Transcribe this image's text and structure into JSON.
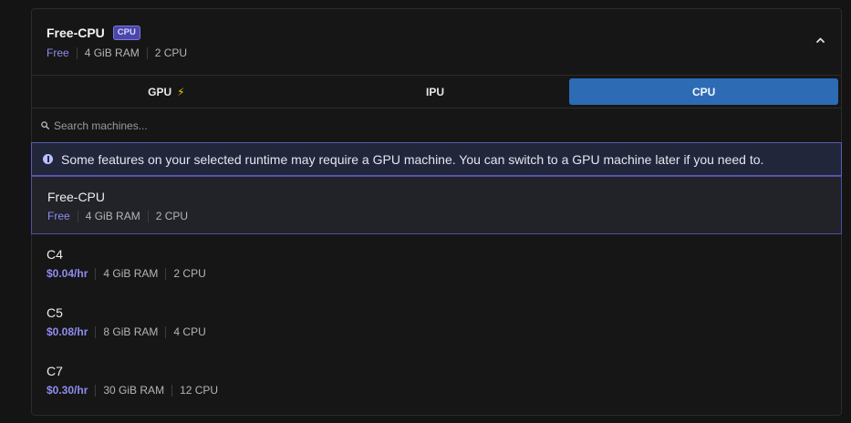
{
  "header": {
    "title": "Free-CPU",
    "badge": "CPU",
    "price": "Free",
    "ram": "4 GiB RAM",
    "cpu": "2 CPU"
  },
  "tabs": [
    {
      "label": "GPU",
      "icon": "lightning-icon"
    },
    {
      "label": "IPU"
    },
    {
      "label": "CPU",
      "active": true
    }
  ],
  "search": {
    "placeholder": "Search machines..."
  },
  "notice": {
    "text": "Some features on your selected runtime may require a GPU machine. You can switch to a GPU machine later if you need to."
  },
  "machines": [
    {
      "name": "Free-CPU",
      "price": "Free",
      "ram": "4 GiB RAM",
      "cpu": "2 CPU",
      "selected": true
    },
    {
      "name": "C4",
      "price": "$0.04/hr",
      "ram": "4 GiB RAM",
      "cpu": "2 CPU"
    },
    {
      "name": "C5",
      "price": "$0.08/hr",
      "ram": "8 GiB RAM",
      "cpu": "4 CPU"
    },
    {
      "name": "C7",
      "price": "$0.30/hr",
      "ram": "30 GiB RAM",
      "cpu": "12 CPU"
    }
  ],
  "colors": {
    "accent": "#2d6bb5",
    "price": "#8f8cf0",
    "badge_bg": "#4a47a8",
    "notice_border": "#5a5ab4"
  }
}
